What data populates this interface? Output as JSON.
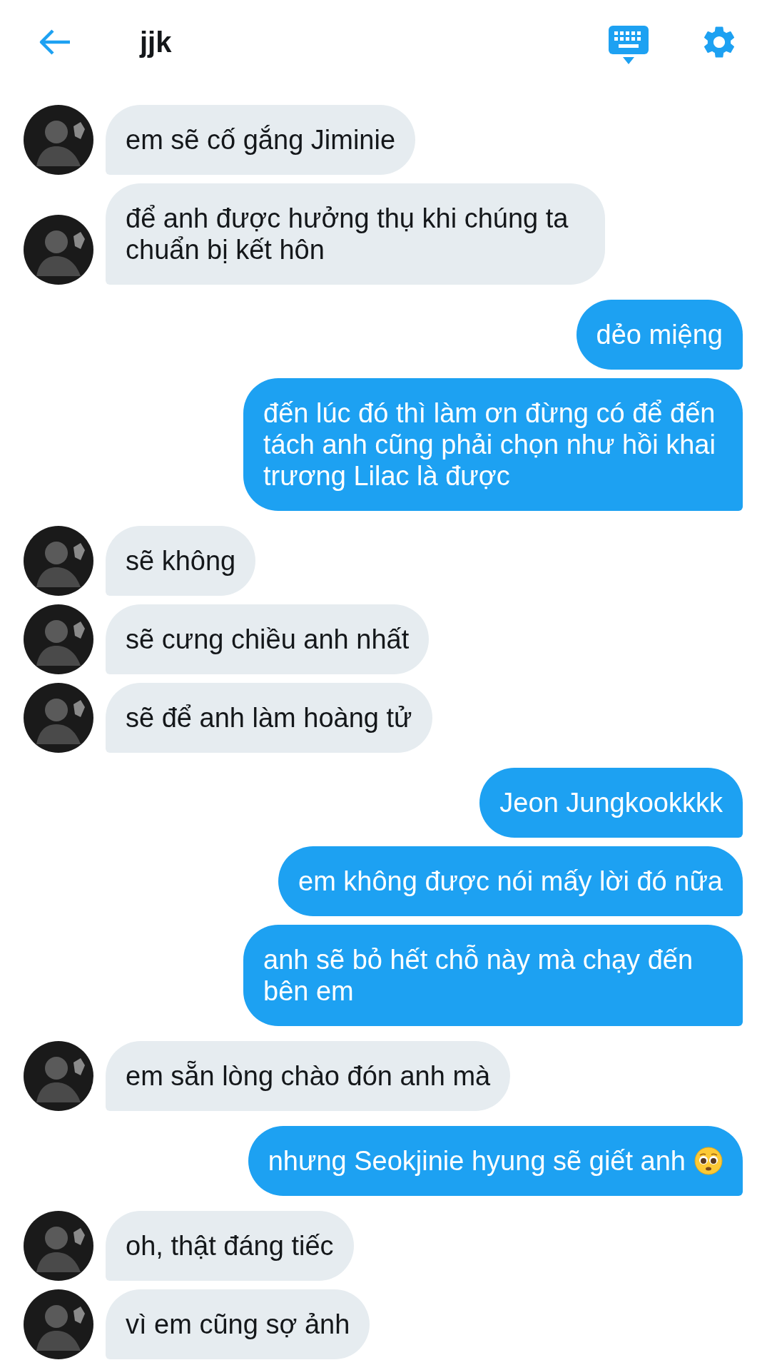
{
  "header": {
    "title": "jjk"
  },
  "messages": [
    {
      "kind": "received",
      "text": "em sẽ cố gắng Jiminie"
    },
    {
      "kind": "received",
      "text": "để anh được hưởng thụ khi chúng ta chuẩn bị kết hôn"
    },
    {
      "kind": "sent",
      "text": "dẻo miệng"
    },
    {
      "kind": "sent",
      "text": "đến lúc đó thì làm ơn đừng có để đến tách anh cũng phải chọn như hồi khai trương Lilac là được"
    },
    {
      "kind": "received",
      "text": "sẽ không"
    },
    {
      "kind": "received",
      "text": "sẽ cưng chiều anh nhất"
    },
    {
      "kind": "received",
      "text": "sẽ để anh làm hoàng tử"
    },
    {
      "kind": "sent",
      "text": "Jeon Jungkookkkk"
    },
    {
      "kind": "sent",
      "text": "em không được nói mấy lời đó nữa"
    },
    {
      "kind": "sent",
      "text": "anh sẽ bỏ hết chỗ này mà chạy đến bên em"
    },
    {
      "kind": "received",
      "text": "em sẵn lòng chào đón anh mà"
    },
    {
      "kind": "sent",
      "text": "nhưng Seokjinie hyung sẽ giết anh",
      "emoji": true
    },
    {
      "kind": "received",
      "text": "oh, thật đáng tiếc"
    },
    {
      "kind": "received",
      "text": "vì em cũng sợ ảnh"
    }
  ]
}
